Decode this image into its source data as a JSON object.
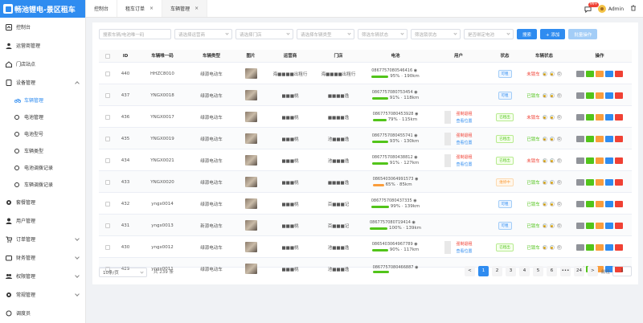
{
  "app": {
    "title": "畅池锂电-景区租车"
  },
  "sidebar": {
    "items": [
      {
        "label": "控制台",
        "icon": "dashboard-icon"
      },
      {
        "label": "运营商管理",
        "icon": "person-icon"
      },
      {
        "label": "门店站点",
        "icon": "home-icon"
      },
      {
        "label": "设备管理",
        "icon": "device-icon",
        "expanded": true
      },
      {
        "label": "套餐管理",
        "icon": "gear-icon"
      },
      {
        "label": "用户管理",
        "icon": "user-icon"
      },
      {
        "label": "订单管理",
        "icon": "cart-icon"
      },
      {
        "label": "财务管理",
        "icon": "wallet-icon"
      },
      {
        "label": "权限管理",
        "icon": "group-icon"
      },
      {
        "label": "常规管理",
        "icon": "gear-icon"
      },
      {
        "label": "调度员",
        "icon": "circle-icon"
      }
    ],
    "device_sub": [
      {
        "label": "车辆管理",
        "active": true
      },
      {
        "label": "电池管理"
      },
      {
        "label": "电池型号"
      },
      {
        "label": "车辆类型"
      },
      {
        "label": "电池调拨记录"
      },
      {
        "label": "车辆调拨记录"
      }
    ]
  },
  "tabs": [
    {
      "label": "控制台"
    },
    {
      "label": "租车订单"
    },
    {
      "label": "车辆管理",
      "active": true
    }
  ],
  "topbar": {
    "badge": "99+",
    "user": "Admin"
  },
  "filters": {
    "search_placeholder": "搜索车辆/电池唯一码",
    "operator_placeholder": "请选择运营商",
    "store_placeholder": "请选择门店",
    "type_placeholder": "请选择车辆类型",
    "rent_status_placeholder": "筛选车辆状态",
    "lock_status_placeholder": "筛选锁状态",
    "battery_bound_placeholder": "是否绑定电池",
    "search_btn": "搜索",
    "add_btn": "+ 添加",
    "batch_btn": "批量操作"
  },
  "table": {
    "headers": [
      "ID",
      "车辆唯一码",
      "车辆类型",
      "图片",
      "运营商",
      "门店",
      "电池",
      "用户",
      "状态",
      "车辆状态",
      "操作"
    ],
    "rows": [
      {
        "id": "440",
        "code": "HHZC8010",
        "type": "绿源电动车",
        "operator": "海■■■■出租行",
        "store": "海■■■■出租行",
        "bat_no": "0867757080546416",
        "bat_pct": "95% · 190km",
        "bat_fill": 0.95,
        "user_links": [],
        "status": "可租",
        "status_kind": "blue",
        "vstate": "未锁车",
        "vstate_kind": "red"
      },
      {
        "id": "437",
        "code": "YNGX0018",
        "type": "绿源电动车",
        "operator": "■■■桃",
        "store": "■■■■逸",
        "bat_no": "0867757080753454",
        "bat_pct": "91% · 118km",
        "bat_fill": 0.91,
        "user_links": [],
        "status": "可租",
        "status_kind": "blue",
        "vstate": "已锁车",
        "vstate_kind": "green"
      },
      {
        "id": "436",
        "code": "YNGX0017",
        "type": "绿源电动车",
        "operator": "■■■桃",
        "store": "■■■■逸",
        "bat_no": "0867757080453928",
        "bat_pct": "79% · 115km",
        "bat_fill": 0.79,
        "user_links": [
          "强制退租",
          "查看位置"
        ],
        "status": "已租出",
        "status_kind": "green",
        "vstate": "未锁车",
        "vstate_kind": "red"
      },
      {
        "id": "435",
        "code": "YNGX0019",
        "type": "绿源电动车",
        "operator": "■■■桃",
        "store": "池■■■逸",
        "bat_no": "0867757080455741",
        "bat_pct": "93% · 130km",
        "bat_fill": 0.93,
        "user_links": [
          "强制退租",
          "查看位置"
        ],
        "status": "已租出",
        "status_kind": "green",
        "vstate": "已锁车",
        "vstate_kind": "green"
      },
      {
        "id": "434",
        "code": "YNGX0021",
        "type": "绿源电动车",
        "operator": "■■■桃",
        "store": "池■■■逸",
        "bat_no": "0867757080438812",
        "bat_pct": "91% · 127km",
        "bat_fill": 0.91,
        "user_links": [
          "强制退租",
          "查看位置"
        ],
        "status": "已租出",
        "status_kind": "green",
        "vstate": "未锁车",
        "vstate_kind": "red"
      },
      {
        "id": "433",
        "code": "YNGX0020",
        "type": "绿源电动车",
        "operator": "■■■桃",
        "store": "■■■■逸",
        "bat_no": "0865403064991573",
        "bat_pct": "65% · 85km",
        "bat_fill": 0.65,
        "user_links": [],
        "status": "维修中",
        "status_kind": "orange",
        "vstate": "已锁车",
        "vstate_kind": "green"
      },
      {
        "id": "432",
        "code": "yngx0014",
        "type": "绿源电动车",
        "operator": "■■■桃",
        "store": "百■■■记",
        "bat_no": "0867757080437335",
        "bat_pct": "99% · 139km",
        "bat_fill": 0.99,
        "user_links": [],
        "status": "可租",
        "status_kind": "blue",
        "vstate": "已锁车",
        "vstate_kind": "green"
      },
      {
        "id": "431",
        "code": "yngx0013",
        "type": "新源电动车",
        "operator": "■■■桃",
        "store": "百■■■记",
        "bat_no": "0867757080719414",
        "bat_pct": "100% · 139km",
        "bat_fill": 1.0,
        "user_links": [],
        "status": "可租",
        "status_kind": "blue",
        "vstate": "已锁车",
        "vstate_kind": "green"
      },
      {
        "id": "430",
        "code": "yngx0012",
        "type": "绿源电动车",
        "operator": "■■■桃",
        "store": "池■■■逸",
        "bat_no": "0865403064967789",
        "bat_pct": "90% · 117km",
        "bat_fill": 0.9,
        "user_links": [
          "强制退租",
          "查看位置"
        ],
        "status": "已租出",
        "status_kind": "green",
        "vstate": "已锁车",
        "vstate_kind": "green"
      },
      {
        "id": "429",
        "code": "yngx0011",
        "type": "绿源电动车",
        "operator": "■■■桃",
        "store": "池■■■逸",
        "bat_no": "0867757080466887",
        "bat_pct": "",
        "bat_fill": 0.9,
        "user_links": [],
        "status": "",
        "status_kind": "blue",
        "vstate": "",
        "vstate_kind": "green"
      }
    ]
  },
  "pager": {
    "size": "10条/页",
    "total": "共 239 条",
    "pages": [
      "<",
      "1",
      "2",
      "3",
      "4",
      "5",
      "6",
      "•••",
      "24",
      ">"
    ],
    "jump_label": "前往",
    "jump_value": "1"
  }
}
